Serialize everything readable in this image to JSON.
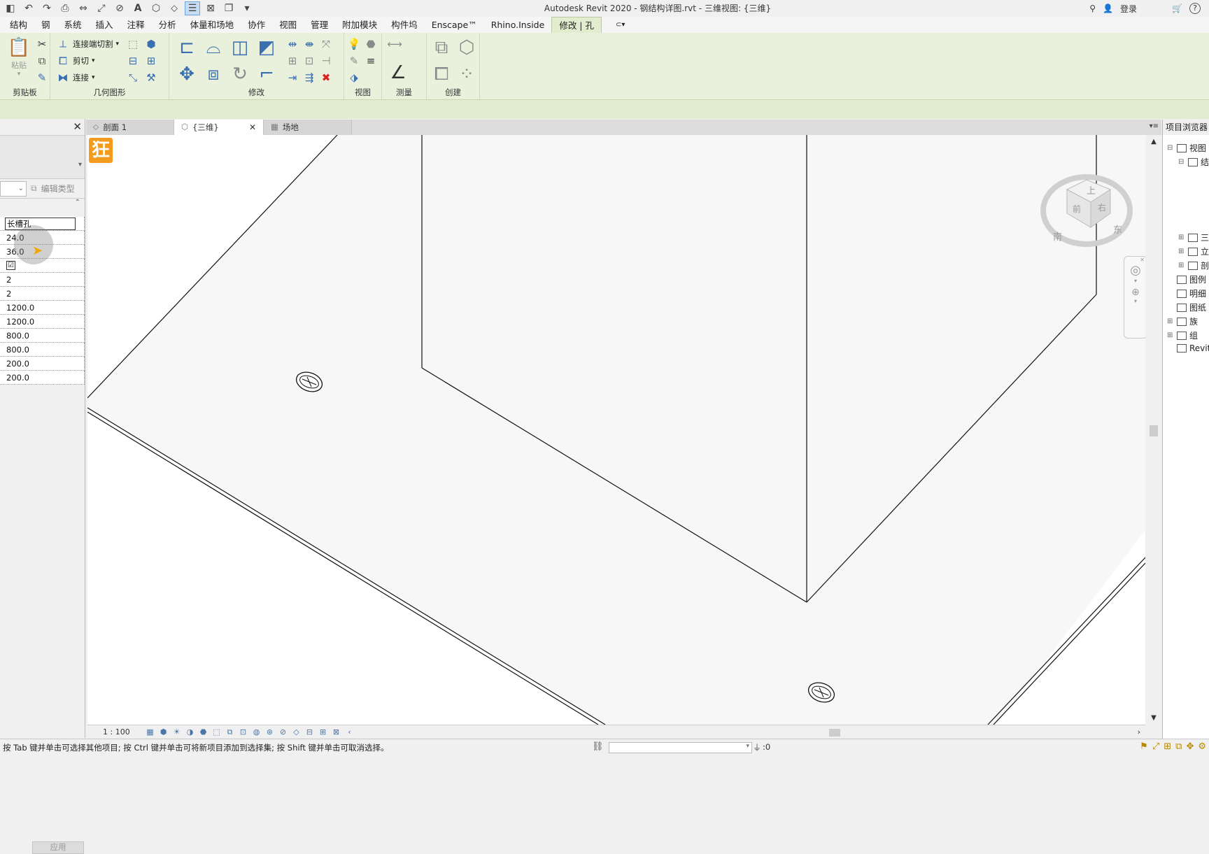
{
  "app": {
    "title": "Autodesk Revit 2020 - 钢结构详图.rvt - 三维视图: {三维}",
    "login": "登录",
    "help": "?"
  },
  "menu": {
    "items": [
      "结构",
      "钢",
      "系统",
      "插入",
      "注释",
      "分析",
      "体量和场地",
      "协作",
      "视图",
      "管理",
      "附加模块",
      "构件坞",
      "Enscape™",
      "Rhino.Inside",
      "修改 | 孔"
    ],
    "active_index": 14
  },
  "ribbon": {
    "paste_label": "粘贴",
    "join_cut_label": "连接端切割",
    "cut_label": "剪切",
    "join_label": "连接",
    "panels": {
      "clipboard": "剪贴板",
      "geometry": "几何图形",
      "modify": "修改",
      "view": "视图",
      "measure": "测量",
      "create": "创建"
    }
  },
  "properties": {
    "edit_type": "编辑类型",
    "apply": "应用",
    "rows": [
      {
        "type": "text",
        "value": "长槽孔",
        "editing": true
      },
      {
        "type": "text",
        "value": "24.0"
      },
      {
        "type": "text",
        "value": "36.0"
      },
      {
        "type": "checkbox",
        "value": "☑"
      },
      {
        "type": "text",
        "value": "2"
      },
      {
        "type": "text",
        "value": "2"
      },
      {
        "type": "text",
        "value": "1200.0"
      },
      {
        "type": "text",
        "value": "1200.0"
      },
      {
        "type": "text",
        "value": "800.0"
      },
      {
        "type": "text",
        "value": "800.0"
      },
      {
        "type": "text",
        "value": "200.0"
      },
      {
        "type": "text",
        "value": "200.0"
      }
    ]
  },
  "view_tabs": [
    {
      "label": "剖面 1",
      "icon": "section-icon"
    },
    {
      "label": "{三维}",
      "icon": "3d-view-icon",
      "active": true
    },
    {
      "label": "场地",
      "icon": "site-plan-icon"
    }
  ],
  "view": {
    "logo_text": "狂",
    "scale": "1 : 100"
  },
  "viewcube": {
    "top": "上",
    "front": "前",
    "right": "右",
    "south": "南",
    "east": "东"
  },
  "browser": {
    "title": "项目浏览器",
    "nodes": [
      {
        "label": "视图",
        "exp": "⊟",
        "level": 0
      },
      {
        "label": "结构",
        "exp": "⊟",
        "level": 1
      },
      {
        "label": "三维",
        "exp": "⊞",
        "level": 1
      },
      {
        "label": "立面",
        "exp": "⊞",
        "level": 1
      },
      {
        "label": "剖面",
        "exp": "⊞",
        "level": 1
      },
      {
        "label": "图例",
        "exp": "",
        "level": 0
      },
      {
        "label": "明细",
        "exp": "",
        "level": 0
      },
      {
        "label": "图纸",
        "exp": "",
        "level": 0
      },
      {
        "label": "族",
        "exp": "⊞",
        "level": 0
      },
      {
        "label": "组",
        "exp": "⊞",
        "level": 0
      },
      {
        "label": "Revit",
        "exp": "",
        "level": 0
      }
    ]
  },
  "status": {
    "text": "按 Tab 键并单击可选择其他项目; 按 Ctrl 键并单击可将新项目添加到选择集; 按 Shift 键并单击可取消选择。",
    "filter_count": ":0"
  },
  "colors": {
    "ribbon_bg": "#e9f1dc",
    "accent": "#f29b1d",
    "highlight": "#c5dcf3"
  }
}
